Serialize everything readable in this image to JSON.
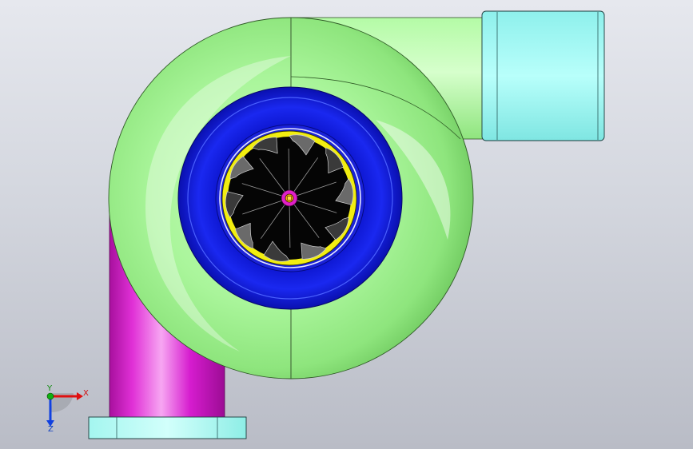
{
  "triad": {
    "x_label": "X",
    "y_label": "Y",
    "z_label": "Z"
  },
  "colors": {
    "background_top": "#e6e8ee",
    "background_bottom": "#b9bcc6",
    "volute_housing": "#9fef8f",
    "inlet_ring": "#1018d8",
    "impeller_backplate": "#f2ee10",
    "impeller_blades": "#050505",
    "hub": "#e020c8",
    "outlet_pipe": "#d818d8",
    "outlet_flange": "#a8f8ef",
    "discharge_pipe": "#a8f89a",
    "discharge_flange": "#88f2ec",
    "axis_x": "#e01010",
    "axis_y": "#10b010",
    "axis_z": "#1040e0"
  },
  "icons": [
    "coordinate-triad-icon"
  ]
}
